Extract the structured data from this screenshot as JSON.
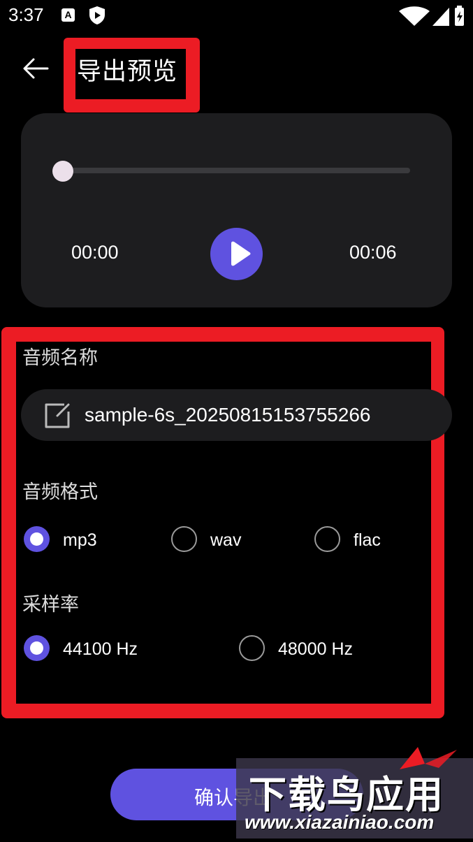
{
  "status_bar": {
    "time": "3:37",
    "icons": [
      "a-notification-icon",
      "shield-icon",
      "wifi-icon",
      "signal-icon",
      "battery-icon"
    ]
  },
  "header": {
    "title": "导出预览",
    "back_icon": "arrow-left-icon"
  },
  "player": {
    "current_time": "00:00",
    "total_time": "00:06",
    "progress": 0,
    "play_icon": "play-icon"
  },
  "form": {
    "name_label": "音频名称",
    "name_value": "sample-6s_20250815153755266",
    "name_icon": "edit-icon",
    "format_label": "音频格式",
    "formats": [
      {
        "label": "mp3",
        "selected": true
      },
      {
        "label": "wav",
        "selected": false
      },
      {
        "label": "flac",
        "selected": false
      }
    ],
    "rate_label": "采样率",
    "rates": [
      {
        "label": "44100 Hz",
        "selected": true
      },
      {
        "label": "48000 Hz",
        "selected": false
      }
    ]
  },
  "confirm_button": {
    "label": "确认导出"
  },
  "watermark": {
    "top": "下载鸟应用",
    "bottom": "www.xiazainiao.com"
  },
  "colors": {
    "accent": "#5f52e0",
    "annotation_red": "#ec1c24",
    "card": "#1d1d1f",
    "background": "#000000"
  }
}
